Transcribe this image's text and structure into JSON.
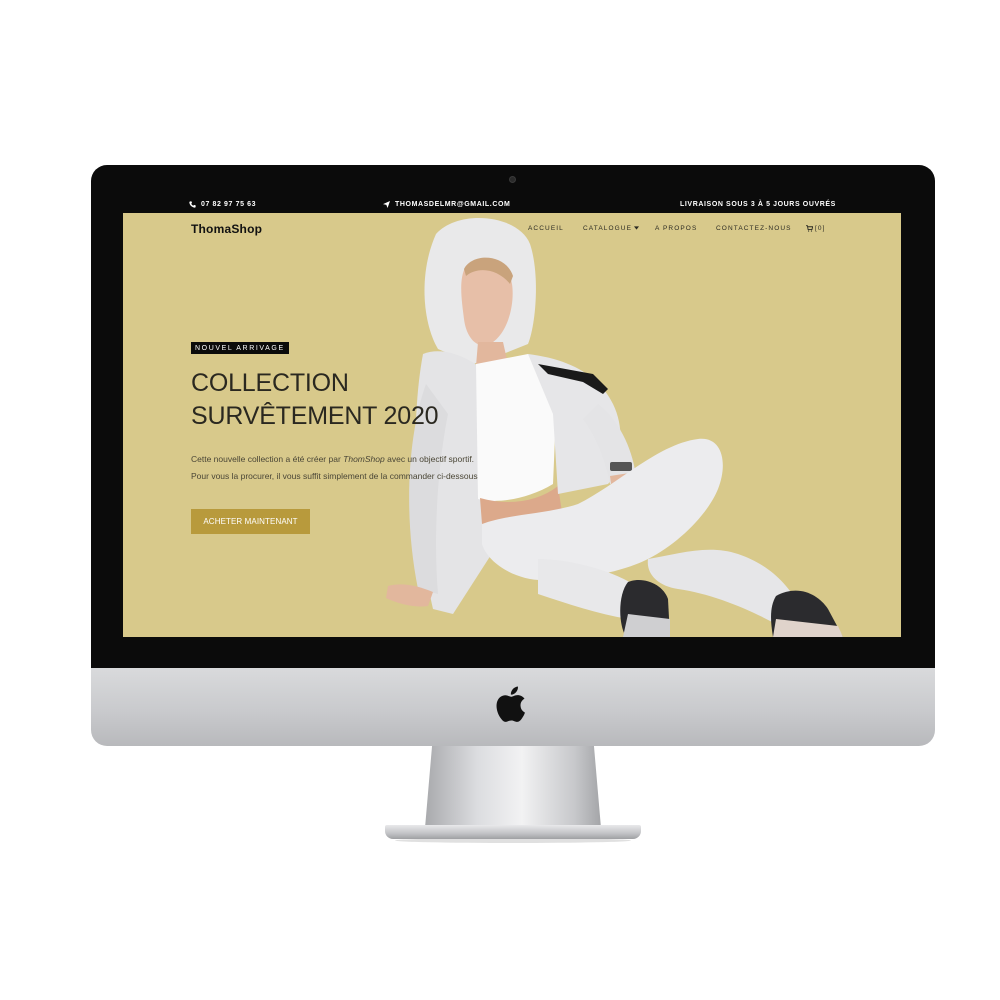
{
  "topbar": {
    "phone": "07 82 97 75 63",
    "email": "THOMASDELMR@GMAIL.COM",
    "shipping": "LIVRAISON SOUS 3 À 5 JOURS OUVRÉS"
  },
  "navbar": {
    "logo": "ThomaShop",
    "items": [
      "ACCUEIL",
      "CATALOGUE",
      "A PROPOS",
      "CONTACTEZ-NOUS"
    ],
    "cart_count": "[0]"
  },
  "hero": {
    "badge": "NOUVEL ARRIVAGE",
    "title_line1": "COLLECTION",
    "title_line2": "SURVÊTEMENT 2020",
    "desc_part1": "Cette nouvelle collection a été créer par ",
    "desc_brand": "ThomShop",
    "desc_part2": " avec un objectif sportif. Pour vous la procurer, il vous suffit simplement de la commander ci-dessous",
    "cta_label": "ACHETER MAINTENANT"
  },
  "colors": {
    "hero_background": "#d8c98b",
    "cta": "#b89a3c",
    "topbar": "#0b0b0b",
    "bezel": "#0b0b0b"
  },
  "icons": [
    "phone-icon",
    "send-icon",
    "chevron-down-icon",
    "cart-icon",
    "apple-logo-icon",
    "camera-icon"
  ]
}
